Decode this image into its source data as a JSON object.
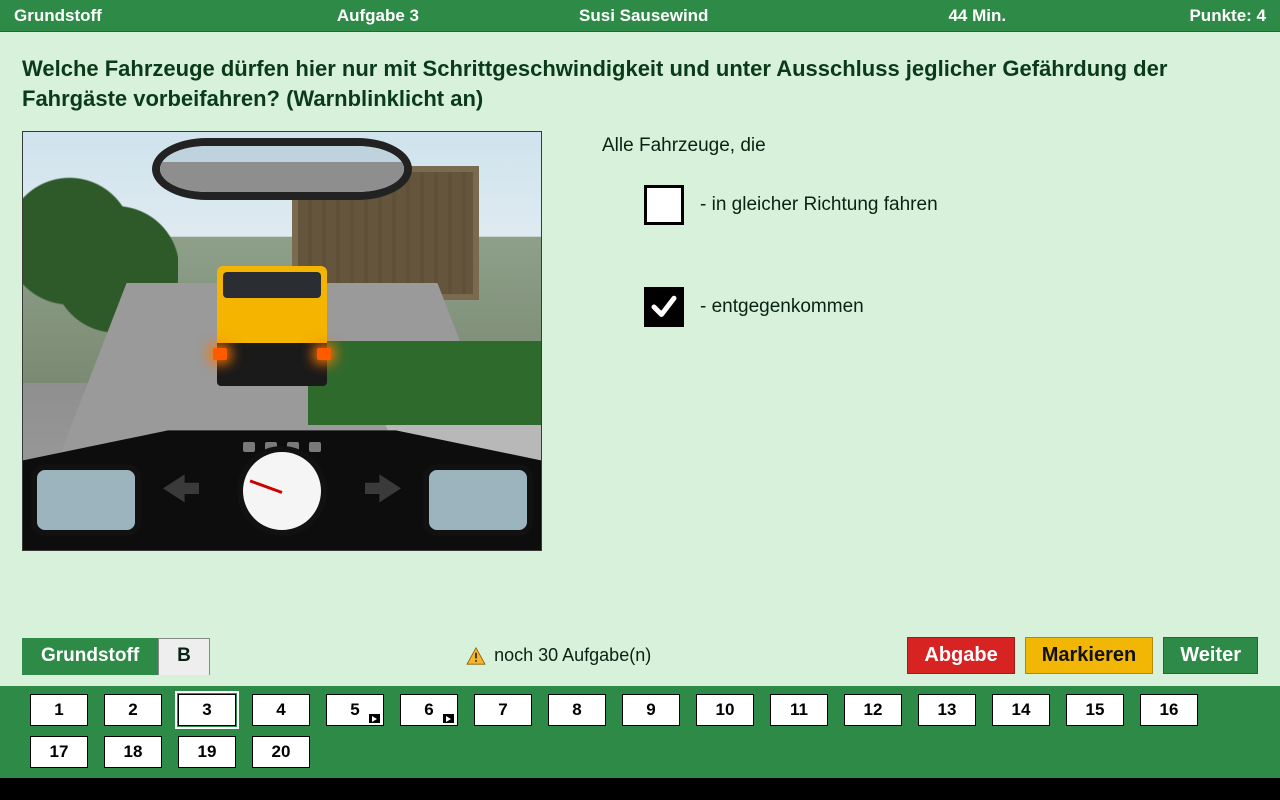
{
  "header": {
    "category": "Grundstoff",
    "task_label": "Aufgabe 3",
    "user": "Susi Sausewind",
    "time": "44 Min.",
    "points": "Punkte: 4"
  },
  "question": "Welche Fahrzeuge dürfen hier nur mit Schrittgeschwindigkeit und unter Ausschluss jeglicher Gefährdung der Fahrgäste vorbeifahren? (Warnblinklicht an)",
  "answers": {
    "lead": "Alle Fahrzeuge, die",
    "items": [
      {
        "text": "- in gleicher Richtung fahren",
        "checked": false
      },
      {
        "text": "- entgegenkommen",
        "checked": true
      }
    ]
  },
  "footer": {
    "tabs": [
      {
        "label": "Grundstoff",
        "active": true
      },
      {
        "label": "B",
        "active": false
      }
    ],
    "remaining": "noch 30 Aufgabe(n)",
    "buttons": {
      "submit": "Abgabe",
      "mark": "Markieren",
      "next": "Weiter"
    }
  },
  "questions_nav": {
    "current": 3,
    "video": [
      5,
      6
    ],
    "items": [
      1,
      2,
      3,
      4,
      5,
      6,
      7,
      8,
      9,
      10,
      11,
      12,
      13,
      14,
      15,
      16,
      17,
      18,
      19,
      20
    ]
  }
}
